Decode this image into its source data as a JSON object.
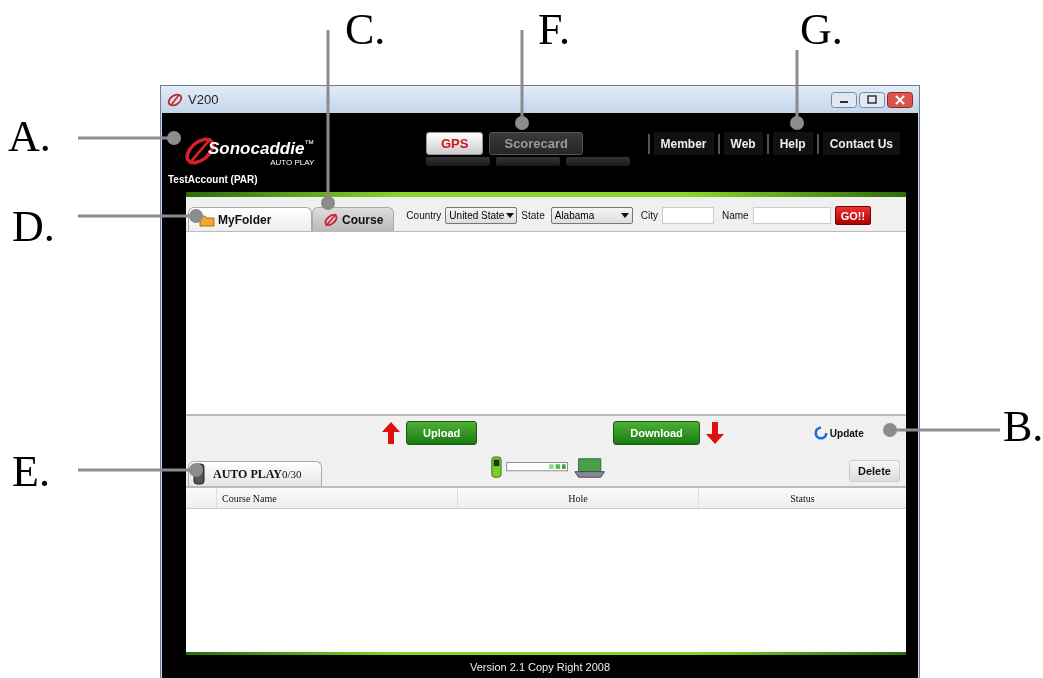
{
  "window": {
    "title": "V200"
  },
  "header": {
    "logo": {
      "name": "Sonocaddie",
      "mark": "™",
      "subtitle": "AUTO PLAY"
    },
    "account": "TestAccount (PAR)"
  },
  "mode_tabs": [
    {
      "label": "GPS",
      "selected": true
    },
    {
      "label": "Scorecard",
      "selected": false
    }
  ],
  "nav_links": [
    "Member",
    "Web",
    "Help",
    "Contact Us"
  ],
  "folder_tabs": [
    {
      "label": "MyFolder",
      "selected": true,
      "kind": "folder"
    },
    {
      "label": "Course",
      "selected": false,
      "kind": "course"
    }
  ],
  "filters": {
    "country": {
      "label": "Country",
      "value": "United State"
    },
    "state": {
      "label": "State",
      "value": "Alabama"
    },
    "city": {
      "label": "City"
    },
    "name": {
      "label": "Name"
    },
    "go": "GO!!"
  },
  "transfer": {
    "upload": "Upload",
    "download": "Download",
    "update": "Update"
  },
  "device": {
    "tab": "AUTO PLAY",
    "count": "0/30",
    "delete": "Delete"
  },
  "table": {
    "columns": [
      "Course Name",
      "Hole",
      "Status"
    ]
  },
  "footer": "Version 2.1 Copy Right 2008",
  "callouts": [
    {
      "label": "C."
    },
    {
      "label": "F."
    },
    {
      "label": "G."
    },
    {
      "label": "A."
    },
    {
      "label": "D."
    },
    {
      "label": "B."
    },
    {
      "label": "E."
    }
  ]
}
